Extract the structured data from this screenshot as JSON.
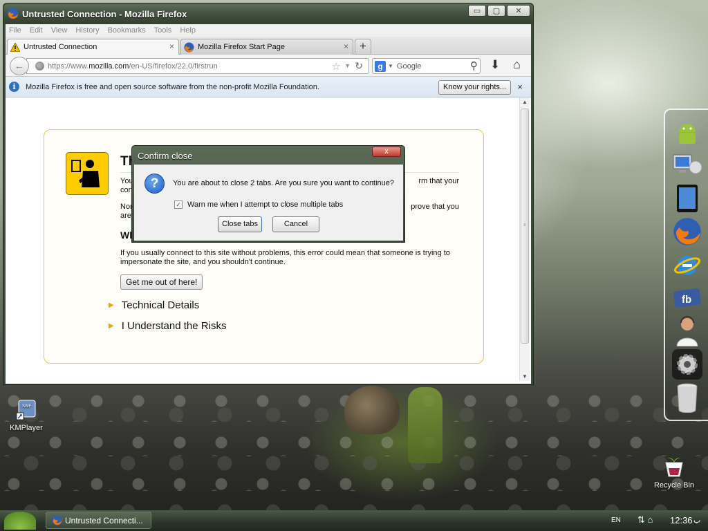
{
  "window": {
    "title": "Untrusted Connection - Mozilla Firefox",
    "controls": {
      "minimize": "▭",
      "maximize": "▢",
      "close": "✕"
    }
  },
  "menubar": [
    "File",
    "Edit",
    "View",
    "History",
    "Bookmarks",
    "Tools",
    "Help"
  ],
  "tabs": [
    {
      "label": "Untrusted Connection",
      "icon": "warning-icon",
      "close": "×"
    },
    {
      "label": "Mozilla Firefox Start Page",
      "icon": "firefox-icon",
      "close": "×"
    }
  ],
  "newtab_label": "+",
  "navbar": {
    "url_prefix": "https://www.",
    "url_domain": "mozilla.com",
    "url_suffix": "/en-US/firefox/22.0/firstrun",
    "search_engine": "g",
    "search_placeholder": "Google"
  },
  "notification": {
    "text": "Mozilla Firefox is free and open source software from the non-profit Mozilla Foundation.",
    "button": "Know your rights...",
    "close": "×"
  },
  "error_page": {
    "title": "This Connection is Untrusted",
    "p1_start": "You",
    "p1_end": "rm that your",
    "p1_line2": "conn",
    "p2_start": "Norm",
    "p2_end": "prove that you",
    "p2_line2": "are",
    "heading2": "Wh",
    "p3": "If you usually connect to this site without problems, this error could mean that someone is trying to impersonate the site, and you shouldn't continue.",
    "get_out_button": "Get me out of here!",
    "expanders": [
      "Technical Details",
      "I Understand the Risks"
    ]
  },
  "dialog": {
    "title": "Confirm close",
    "close_label": "x",
    "message": "You are about to close 2 tabs. Are you sure you want to continue?",
    "checkbox_label": "Warn me when I attempt to close multiple tabs",
    "checkbox_checked": true,
    "primary_button": "Close tabs",
    "secondary_button": "Cancel"
  },
  "dock": [
    "android-icon",
    "computer-icon",
    "ipad-icon",
    "firefox-icon",
    "internet-explorer-icon",
    "facebook-icon",
    "support-person-icon",
    "settings-gear-icon",
    "trash-can-icon"
  ],
  "desktop": {
    "kmplayer_label": "KMPlayer",
    "recycle_label": "Recycle Bin"
  },
  "taskbar": {
    "task_label": "Untrusted Connecti...",
    "language": "EN",
    "time": "12:36",
    "ampm": "ب"
  },
  "colors": {
    "titlebar": "#3f4d3c",
    "error_border": "#e7c65a",
    "info_blue": "#2f6fc4"
  }
}
